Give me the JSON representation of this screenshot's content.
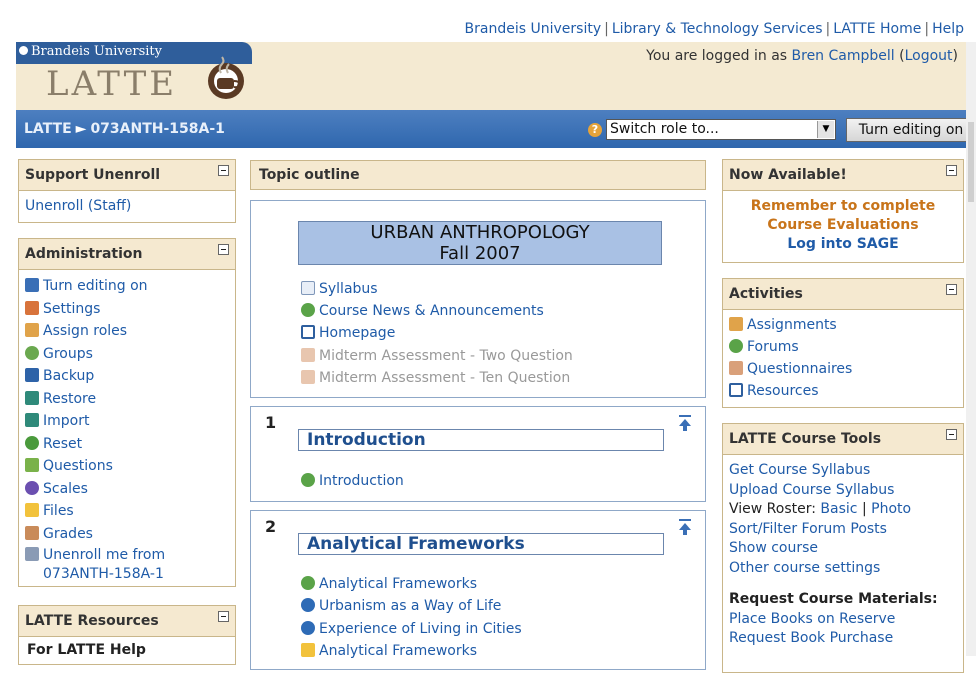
{
  "toplinks": [
    "Brandeis University",
    "Library & Technology Services",
    "LATTE Home",
    "Help"
  ],
  "header": {
    "university": "Brandeis University",
    "site_name": "LATTE",
    "logged_in_prefix": "You are logged in as",
    "user_name": "Bren Campbell",
    "logout_label": "Logout"
  },
  "navbar": {
    "crumb_root": "LATTE",
    "crumb_course": "073ANTH-158A-1",
    "switch_role_placeholder": "Switch role to...",
    "edit_button": "Turn editing on"
  },
  "left": {
    "support_title": "Support Unenroll",
    "support_items": [
      "Unenroll (Staff)"
    ],
    "admin_title": "Administration",
    "admin_items": [
      {
        "label": "Turn editing on",
        "icon": "edit-icon"
      },
      {
        "label": "Settings",
        "icon": "settings-icon"
      },
      {
        "label": "Assign roles",
        "icon": "roles-icon"
      },
      {
        "label": "Groups",
        "icon": "groups-icon"
      },
      {
        "label": "Backup",
        "icon": "backup-icon"
      },
      {
        "label": "Restore",
        "icon": "restore-icon"
      },
      {
        "label": "Import",
        "icon": "import-icon"
      },
      {
        "label": "Reset",
        "icon": "reset-icon"
      },
      {
        "label": "Questions",
        "icon": "questions-icon"
      },
      {
        "label": "Scales",
        "icon": "scales-icon"
      },
      {
        "label": "Files",
        "icon": "folder-icon"
      },
      {
        "label": "Grades",
        "icon": "grades-icon"
      }
    ],
    "unenroll_label": "Unenroll me from",
    "unenroll_course": "073ANTH-158A-1",
    "resources_title": "LATTE Resources",
    "resources_sub": "For LATTE Help"
  },
  "center": {
    "topic_outline": "Topic outline",
    "course_title_line1": "URBAN ANTHROPOLOGY",
    "course_title_line2": "Fall 2007",
    "section0_items": [
      {
        "label": "Syllabus",
        "icon": "document-icon",
        "dim": false
      },
      {
        "label": "Course News & Announcements",
        "icon": "forum-icon",
        "dim": false
      },
      {
        "label": "Homepage",
        "icon": "window-icon",
        "dim": false
      },
      {
        "label": "Midterm Assessment - Two Question",
        "icon": "questionnaire-icon",
        "dim": true
      },
      {
        "label": "Midterm Assessment - Ten Question",
        "icon": "questionnaire-icon",
        "dim": true
      }
    ],
    "section1": {
      "number": "1",
      "title": "Introduction",
      "items": [
        {
          "label": "Introduction",
          "icon": "forum-icon"
        }
      ]
    },
    "section2": {
      "number": "2",
      "title": "Analytical Frameworks",
      "items": [
        {
          "label": "Analytical Frameworks",
          "icon": "forum-icon"
        },
        {
          "label": "Urbanism as a Way of Life",
          "icon": "globe-link-icon"
        },
        {
          "label": "Experience of Living in Cities",
          "icon": "globe-link-icon"
        },
        {
          "label": "Analytical Frameworks",
          "icon": "folder-icon"
        }
      ]
    }
  },
  "right": {
    "now_title": "Now Available!",
    "now_line1": "Remember to complete",
    "now_line2": "Course Evaluations",
    "now_link": "Log into SAGE",
    "activities_title": "Activities",
    "activities": [
      {
        "label": "Assignments",
        "icon": "assignment-icon"
      },
      {
        "label": "Forums",
        "icon": "forum-icon"
      },
      {
        "label": "Questionnaires",
        "icon": "questionnaire-icon"
      },
      {
        "label": "Resources",
        "icon": "window-icon"
      }
    ],
    "tools_title": "LATTE Course Tools",
    "tools": [
      "Get Course Syllabus",
      "Upload Course Syllabus"
    ],
    "view_roster_prefix": "View Roster:",
    "roster_basic": "Basic",
    "roster_photo": "Photo",
    "tools2": [
      "Sort/Filter Forum Posts",
      "Show course",
      "Other course settings"
    ],
    "materials_title": "Request Course Materials:",
    "materials": [
      "Place Books on Reserve",
      "Request Book Purchase"
    ]
  },
  "colors": {
    "nav": "#3a70b4",
    "tan": "#f5e9d0",
    "link": "#1f5ba8",
    "eval": "#c8741a"
  }
}
